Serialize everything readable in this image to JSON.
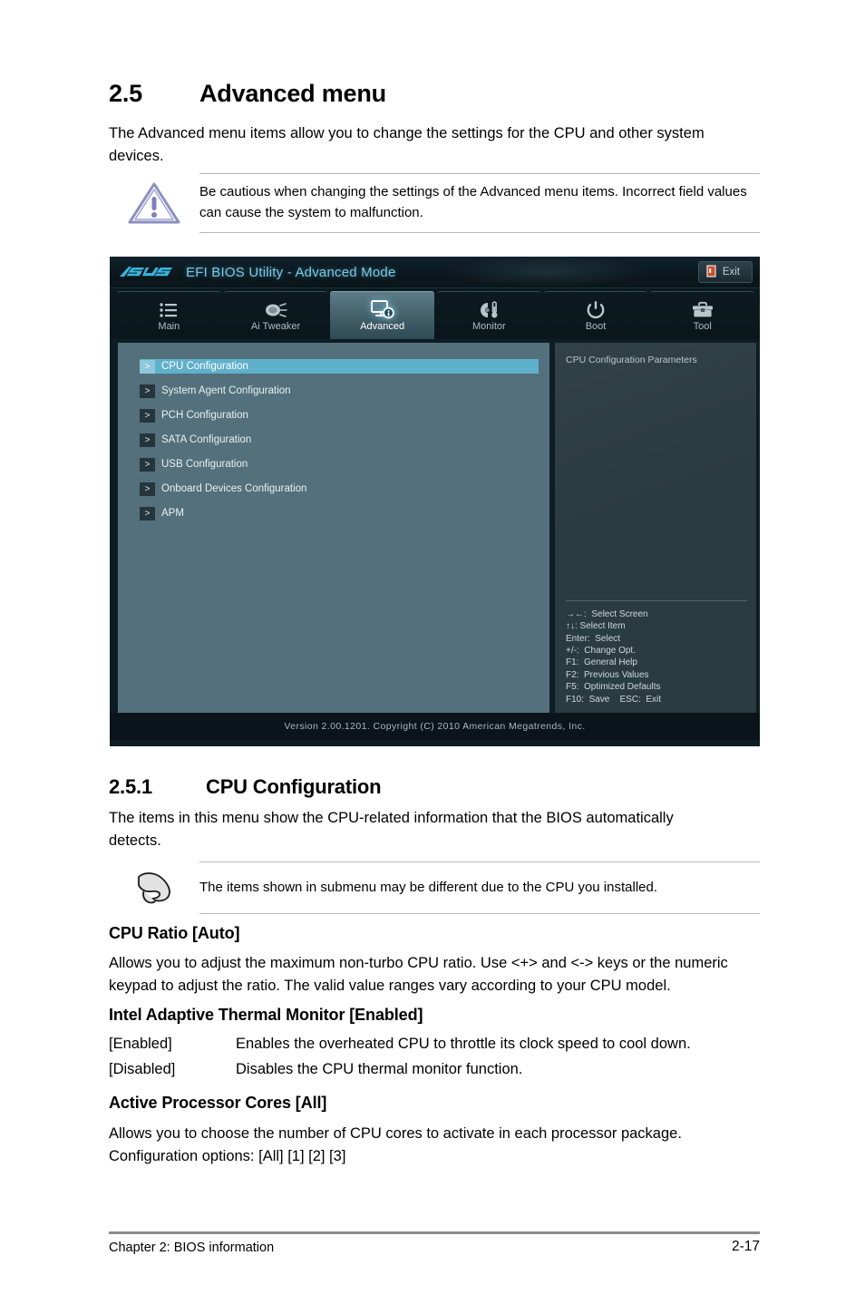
{
  "document": {
    "section": {
      "number": "2.5",
      "title": "Advanced menu"
    },
    "intro": "The Advanced menu items allow you to change the settings for the CPU and other system devices.",
    "caution": {
      "icon": "caution-triangle-icon",
      "text": "Be cautious when changing the settings of the Advanced menu items. Incorrect field values can cause the system to malfunction."
    },
    "subsection": {
      "number": "2.5.1",
      "title": "CPU Configuration"
    },
    "subsection_intro": "The items in this menu show the CPU-related information that the BIOS automatically detects.",
    "note": {
      "icon": "pointing-hand-icon",
      "text": "The items shown in submenu may be different due to the CPU you installed."
    },
    "items": [
      {
        "heading": "CPU Ratio [Auto]",
        "body": "Allows you to adjust the maximum non-turbo CPU ratio. Use <+> and <-> keys or the numeric keypad to adjust the ratio. The valid value ranges vary according to your CPU model."
      },
      {
        "heading": "Intel Adaptive Thermal Monitor [Enabled]",
        "options": [
          {
            "key": "[Enabled]",
            "desc": "Enables the overheated CPU to throttle its clock speed to cool down."
          },
          {
            "key": "[Disabled]",
            "desc": "Disables the CPU thermal monitor function."
          }
        ]
      },
      {
        "heading": "Active Processor Cores [All]",
        "body_line1": "Allows you to choose the number of CPU cores to activate in each processor package.",
        "body_line2": "Configuration options: [All] [1] [2] [3]"
      }
    ],
    "footer": {
      "left": "Chapter 2: BIOS information",
      "page": "2-17"
    }
  },
  "bios": {
    "brand": "ASUS",
    "title": "EFI BIOS Utility - Advanced Mode",
    "exit_label": "Exit",
    "exit_icon": "exit-door-icon",
    "tabs": [
      {
        "label": "Main",
        "icon": "list-icon",
        "active": false
      },
      {
        "label": "Ai  Tweaker",
        "icon": "tuning-knob-icon",
        "active": false
      },
      {
        "label": "Advanced",
        "icon": "monitor-info-icon",
        "active": true
      },
      {
        "label": "Monitor",
        "icon": "fan-thermometer-icon",
        "active": false
      },
      {
        "label": "Boot",
        "icon": "power-icon",
        "active": false
      },
      {
        "label": "Tool",
        "icon": "toolbox-icon",
        "active": false
      }
    ],
    "menu_items": [
      {
        "label": "CPU Configuration",
        "selected": true
      },
      {
        "label": "System Agent Configuration",
        "selected": false
      },
      {
        "label": "PCH Configuration",
        "selected": false
      },
      {
        "label": "SATA Configuration",
        "selected": false
      },
      {
        "label": "USB Configuration",
        "selected": false
      },
      {
        "label": "Onboard Devices Configuration",
        "selected": false
      },
      {
        "label": "APM",
        "selected": false
      }
    ],
    "arrow_glyph": ">",
    "help_text": "CPU Configuration Parameters",
    "legend": [
      "→←:  Select Screen",
      "↑↓: Select Item",
      "Enter:  Select",
      "+/-:  Change Opt.",
      "F1:  General Help",
      "F2:  Previous Values",
      "F5:  Optimized Defaults",
      "F10:  Save    ESC:  Exit"
    ],
    "version_footer": "Version  2.00.1201.   Copyright  (C)  2010  American  Megatrends,  Inc.",
    "colors": {
      "accent_cyan": "#7ec8e3",
      "left_panel": "#53707c",
      "right_panel": "#2b3b42",
      "selection": "#5fb0cb"
    }
  }
}
